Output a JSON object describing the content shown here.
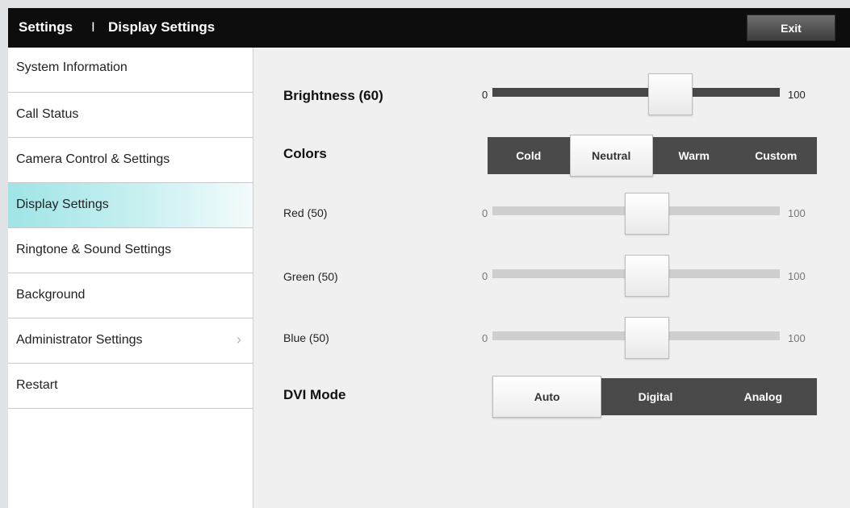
{
  "header": {
    "title_root": "Settings",
    "title_sep": "I",
    "title_page": "Display Settings",
    "exit_label": "Exit"
  },
  "sidebar": {
    "items": [
      {
        "label": "System Information"
      },
      {
        "label": "Call Status"
      },
      {
        "label": "Camera Control & Settings"
      },
      {
        "label": "Display Settings",
        "active": true
      },
      {
        "label": "Ringtone & Sound Settings"
      },
      {
        "label": "Background"
      },
      {
        "label": "Administrator Settings",
        "icon": "chevron-right-icon"
      },
      {
        "label": "Restart"
      }
    ]
  },
  "brightness": {
    "label": "Brightness (60)",
    "min": "0",
    "max": "100",
    "value": 60
  },
  "colors": {
    "label": "Colors",
    "options": [
      "Cold",
      "Neutral",
      "Warm",
      "Custom"
    ],
    "selected": "Neutral"
  },
  "red": {
    "label": "Red (50)",
    "min": "0",
    "max": "100",
    "value": 50
  },
  "green": {
    "label": "Green (50)",
    "min": "0",
    "max": "100",
    "value": 50
  },
  "blue": {
    "label": "Blue (50)",
    "min": "0",
    "max": "100",
    "value": 50
  },
  "dvi": {
    "label": "DVI Mode",
    "options": [
      "Auto",
      "Digital",
      "Analog"
    ],
    "selected": "Auto"
  },
  "colors_palette": {
    "topbar": "#0d0d0d",
    "active_item": "#9fe4e6",
    "track_dark": "#474747",
    "track_light": "#cfcfcf"
  }
}
